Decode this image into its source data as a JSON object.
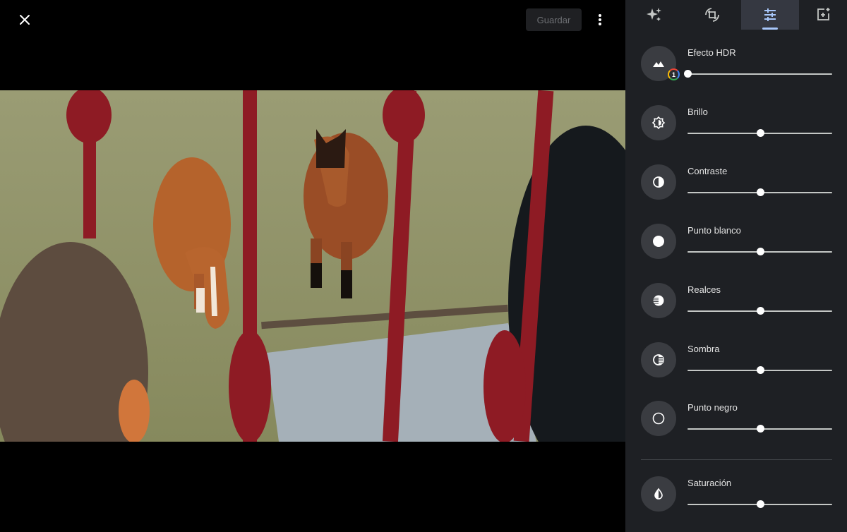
{
  "toolbar": {
    "close_icon": "close-icon",
    "save_label": "Guardar",
    "more_icon": "more-vert-icon"
  },
  "photo": {
    "description": "Two horses in a grassy field seen through red balcony railings, with two people's heads in the foreground"
  },
  "panel": {
    "tabs": [
      {
        "name": "suggestions",
        "icon": "sparkle-icon",
        "active": false
      },
      {
        "name": "crop-rotate",
        "icon": "crop-rotate-icon",
        "active": false
      },
      {
        "name": "adjust",
        "icon": "tune-icon",
        "active": true
      },
      {
        "name": "export",
        "icon": "add-to-photo-icon",
        "active": false
      }
    ],
    "adjustments": [
      {
        "label": "Efecto HDR",
        "icon": "landscape-icon",
        "value": 0,
        "badge": "1"
      },
      {
        "label": "Brillo",
        "icon": "brightness-icon",
        "value": 0.5
      },
      {
        "label": "Contraste",
        "icon": "contrast-icon",
        "value": 0.5
      },
      {
        "label": "Punto blanco",
        "icon": "white-point-icon",
        "value": 0.5
      },
      {
        "label": "Realces",
        "icon": "highlights-icon",
        "value": 0.5
      },
      {
        "label": "Sombra",
        "icon": "shadows-icon",
        "value": 0.5
      },
      {
        "label": "Punto negro",
        "icon": "black-point-icon",
        "value": 0.5
      }
    ],
    "color_adjustments": [
      {
        "label": "Saturación",
        "icon": "saturation-icon",
        "value": 0.5
      }
    ]
  },
  "colors": {
    "panel_bg": "#1e2024",
    "active_tab_bg": "#353841",
    "accent": "#a8c7fa"
  }
}
